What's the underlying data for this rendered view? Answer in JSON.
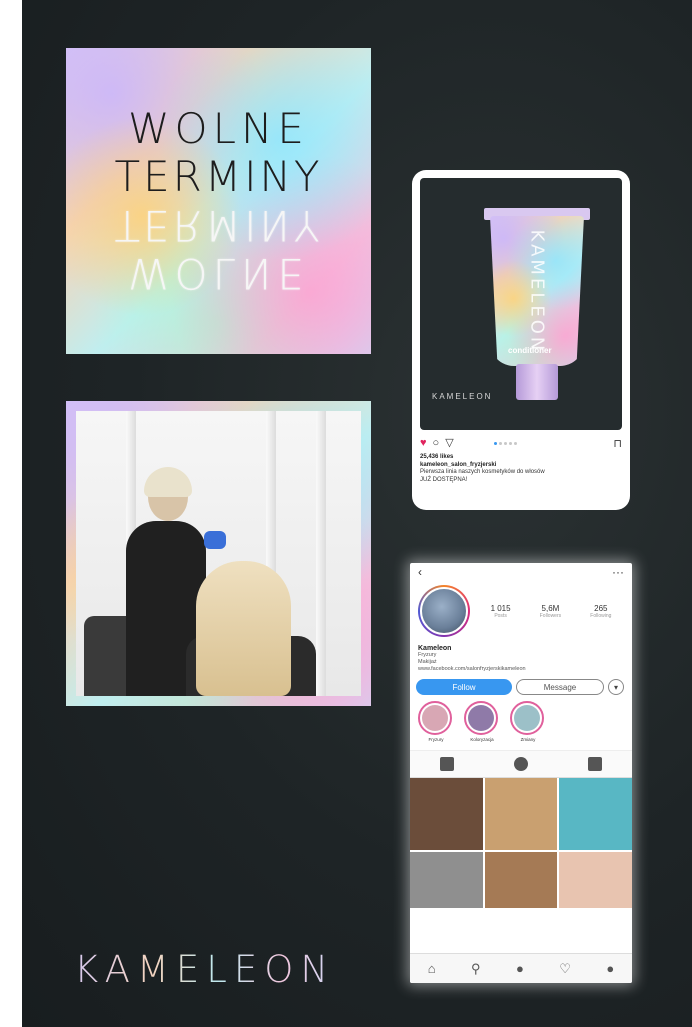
{
  "colors": {
    "background": "#1e2426",
    "follow_button": "#3897f0",
    "like_heart": "#e0245e"
  },
  "poster": {
    "line1": "WOLNE",
    "line2": "TERMINY",
    "mirror_line1": "TERMINY",
    "mirror_line2": "WOLNE"
  },
  "post": {
    "image_brand": "KAMELEON",
    "product_label": "conditioner",
    "logo_text": "KAMELEON",
    "likes": "25,436 likes",
    "username": "kameleon_salon_fryzjerski",
    "caption_line1": "Pierwsza linia naszych kosmetyków do włosów",
    "caption_line2": "JUŻ DOSTĘPNA!",
    "icons": [
      "heart-icon",
      "comment-icon",
      "share-icon",
      "bookmark-icon"
    ]
  },
  "profile": {
    "back_icon": "‹",
    "more_icon": "···",
    "stats": [
      {
        "value": "1 015",
        "label": "Posts"
      },
      {
        "value": "5,6M",
        "label": "Followers"
      },
      {
        "value": "265",
        "label": "Following"
      }
    ],
    "name": "Kameleon",
    "bio_line1": "Fryzury",
    "bio_line2": "Makijaż",
    "website": "www.facebook.com/salonfryzjerskikameleon",
    "follow_label": "Follow",
    "message_label": "Message",
    "more_label": "▾",
    "highlights": [
      {
        "label": "Fryzury",
        "color": "#d8a7b4"
      },
      {
        "label": "Koloryzacja",
        "color": "#8f7aa8"
      },
      {
        "label": "Zmiany",
        "color": "#9cc0c8"
      }
    ],
    "tiles": [
      {
        "color": "#6b4d3a"
      },
      {
        "color": "#c9a070"
      },
      {
        "color": "#58b7c4"
      },
      {
        "color": "#8f8f8f"
      },
      {
        "color": "#a57a55"
      },
      {
        "color": "#e8c4b0"
      }
    ],
    "bottom_icons": [
      "home-icon",
      "search-icon",
      "add-icon",
      "heart-icon",
      "profile-icon"
    ]
  },
  "brand": {
    "text": "KAMELEON"
  }
}
